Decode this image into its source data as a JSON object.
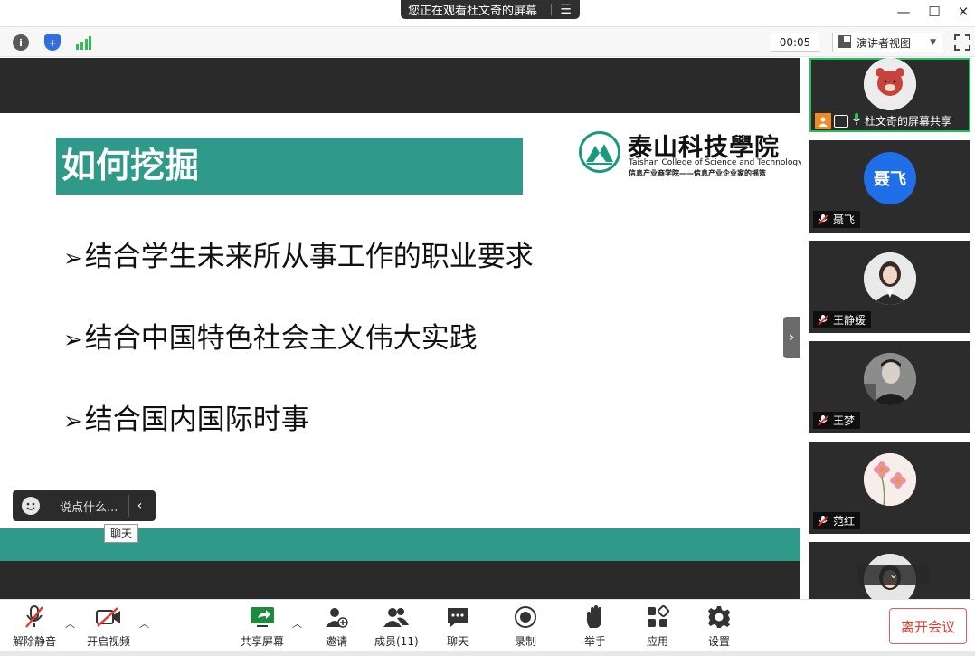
{
  "banner": {
    "text": "您正在观看杜文奇的屏幕",
    "menu_icon": "menu-icon"
  },
  "window_controls": {
    "minimize": "—",
    "maximize": "☐",
    "close": "✕"
  },
  "toolbar": {
    "info_icon": "info-icon",
    "shield_icon": "shield-icon",
    "signal_icon": "signal-icon",
    "timer": "00:05",
    "view_label": "演讲者视图",
    "fullscreen_icon": "fullscreen-icon"
  },
  "slide": {
    "title": "如何挖掘",
    "bullets": [
      "结合学生未来所从事工作的职业要求",
      "结合中国特色社会主义伟大实践",
      "结合国内国际时事"
    ],
    "bullet_marker": "➢",
    "logo": {
      "name": "泰山科技學院",
      "english": "Taishan College of Science and Technology",
      "motto": "信息产业商学院——信息产业企业家的摇篮"
    }
  },
  "chat": {
    "placeholder": "说点什么...",
    "tooltip": "聊天"
  },
  "participants": [
    {
      "name": "杜文奇的屏幕共享",
      "type": "photo",
      "active": true,
      "muted": false
    },
    {
      "name": "聂飞",
      "type": "initials",
      "initials": "聂飞",
      "avatar_color": "#1f6fe8",
      "muted": true
    },
    {
      "name": "王静媛",
      "type": "photo",
      "muted": true
    },
    {
      "name": "王梦",
      "type": "photo",
      "muted": true
    },
    {
      "name": "范红",
      "type": "photo",
      "muted": true
    },
    {
      "name": "",
      "type": "photo",
      "muted": true
    }
  ],
  "bottom": {
    "mute": "解除静音",
    "video": "开启视频",
    "share": "共享屏幕",
    "invite": "邀请",
    "members": "成员(11)",
    "chat": "聊天",
    "record": "录制",
    "raise_hand": "举手",
    "apps": "应用",
    "settings": "设置",
    "leave": "离开会议"
  },
  "colors": {
    "accent": "#2f9a8a",
    "active_speaker": "#1fbf5a",
    "leave": "#e0392f"
  }
}
